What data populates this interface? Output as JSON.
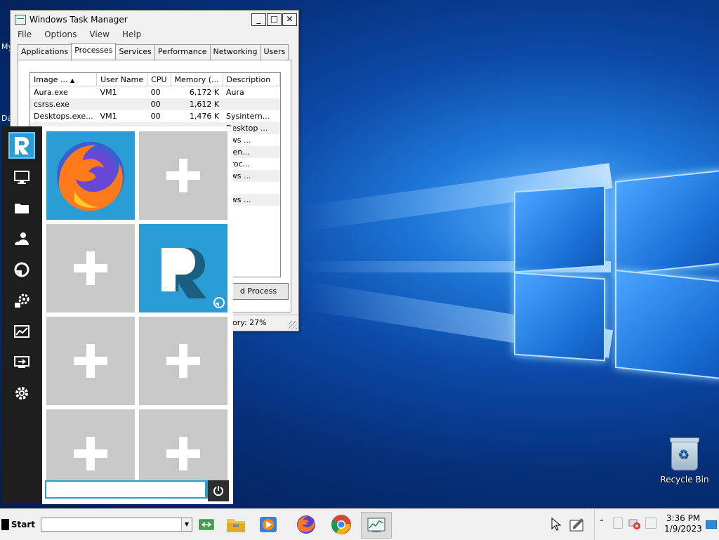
{
  "desktop": {
    "edge_labels": [
      "My",
      "Da"
    ],
    "recycle_bin_label": "Recycle Bin"
  },
  "task_manager": {
    "title": "Windows Task Manager",
    "menu": [
      "File",
      "Options",
      "View",
      "Help"
    ],
    "tabs": [
      "Applications",
      "Processes",
      "Services",
      "Performance",
      "Networking",
      "Users"
    ],
    "active_tab": "Processes",
    "columns": [
      "Image ...",
      "User Name",
      "CPU",
      "Memory (...",
      "Description"
    ],
    "rows": [
      {
        "image": "Aura.exe",
        "user": "VM1",
        "cpu": "00",
        "memory": "6,172 K",
        "description": "Aura"
      },
      {
        "image": "csrss.exe",
        "user": "",
        "cpu": "00",
        "memory": "1,612 K",
        "description": ""
      },
      {
        "image": "Desktops.exe...",
        "user": "VM1",
        "cpu": "00",
        "memory": "1,476 K",
        "description": "Sysintern..."
      },
      {
        "image": "",
        "user": "",
        "cpu": "",
        "memory": "",
        "description": "Desktop ..."
      },
      {
        "image": "",
        "user": "",
        "cpu": "",
        "memory": "",
        "description": "ows ..."
      },
      {
        "image": "",
        "user": "",
        "cpu": "",
        "memory": "",
        "description": "Men..."
      },
      {
        "image": "",
        "user": "",
        "cpu": "",
        "memory": "",
        "description": "Proc..."
      },
      {
        "image": "",
        "user": "",
        "cpu": "",
        "memory": "",
        "description": "ows ..."
      },
      {
        "image": "",
        "user": "",
        "cpu": "",
        "memory": "",
        "description": ""
      },
      {
        "image": "",
        "user": "",
        "cpu": "",
        "memory": "",
        "description": "ows ..."
      }
    ],
    "end_process_label": "d Process",
    "status_memory": "ory: 27%"
  },
  "launcher": {
    "sidebar_icons": [
      "logo-icon",
      "monitor-icon",
      "folder-icon",
      "users-icon",
      "remote-icon",
      "settings-gear-icon",
      "performance-chart-icon",
      "screen-share-icon",
      "gear-icon"
    ],
    "tiles": [
      "firefox",
      "add",
      "add",
      "app",
      "add",
      "add",
      "add",
      "add"
    ],
    "search_value": "",
    "accent_color": "#2a9ed4"
  },
  "taskbar": {
    "start_label": "Start",
    "address_value": "",
    "clock_time": "3:36 PM",
    "clock_date": "1/9/2023"
  }
}
